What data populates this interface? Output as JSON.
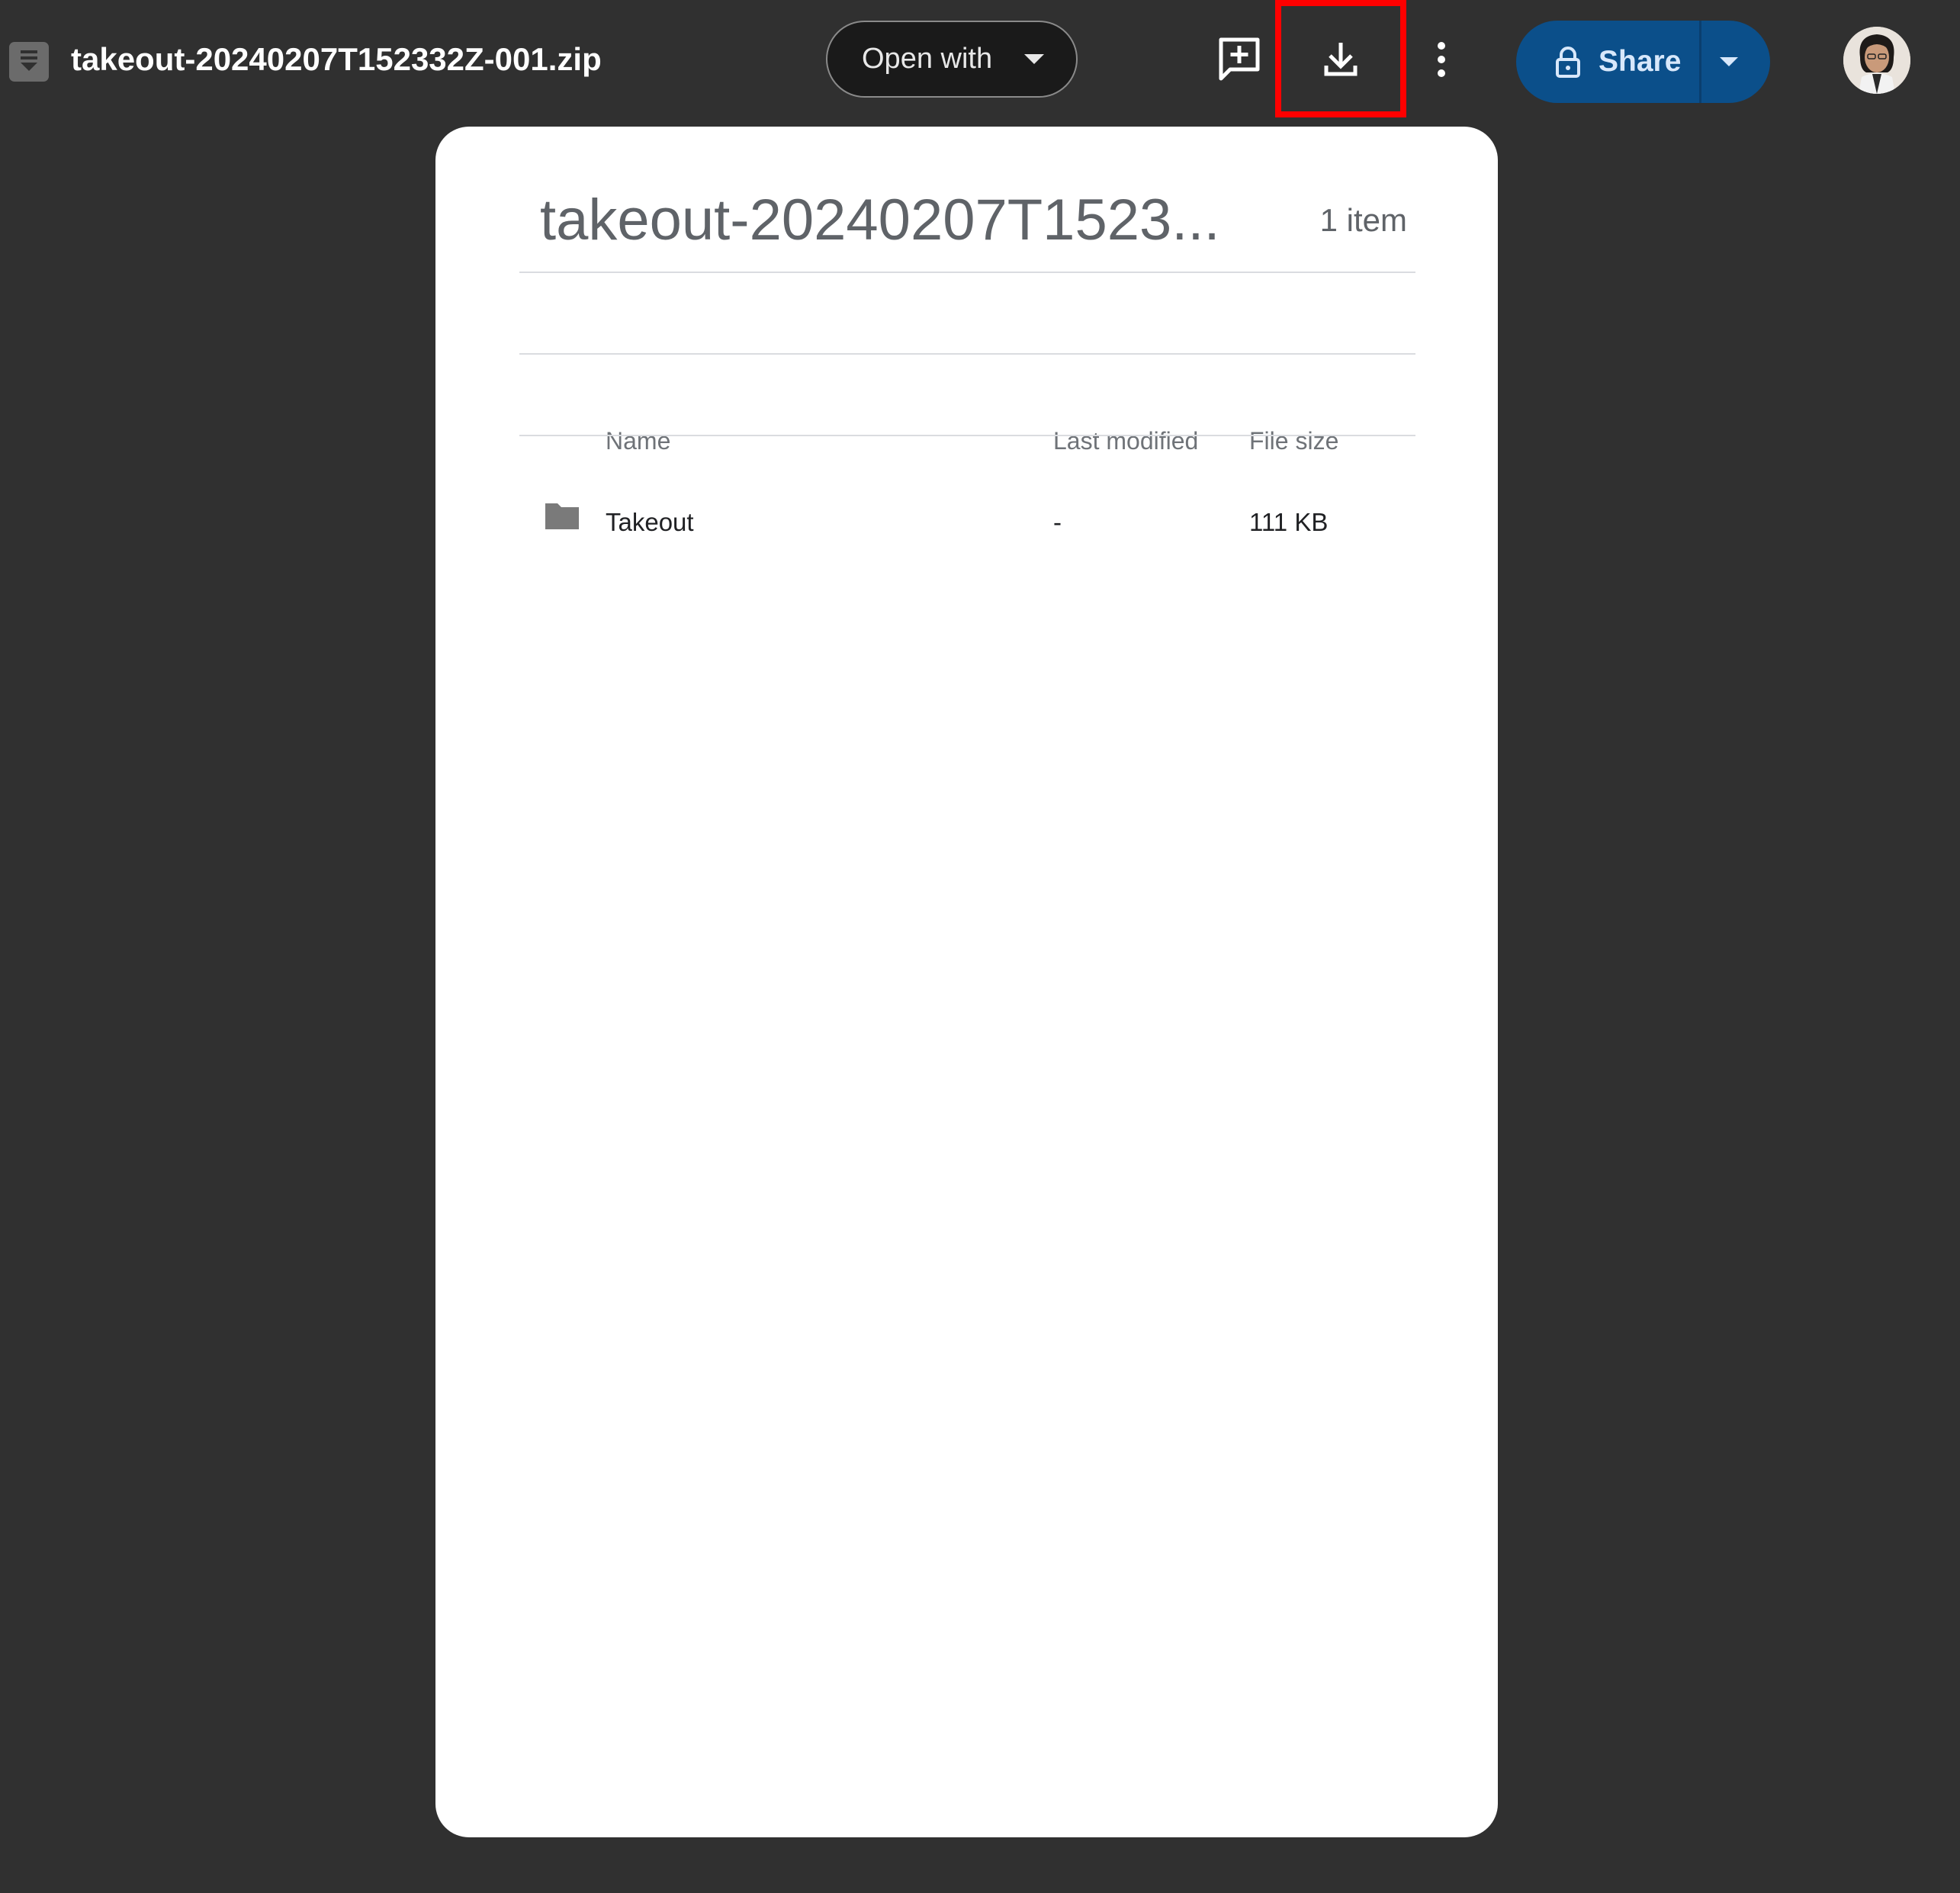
{
  "header": {
    "file_title": "takeout-20240207T152332Z-001.zip",
    "open_with_label": "Open with",
    "share_label": "Share"
  },
  "icons": {
    "file_type": "zip-file-icon",
    "open_with_caret": "chevron-down-icon",
    "add_comment": "add-comment-icon",
    "download": "download-icon",
    "more": "more-vert-icon",
    "lock": "lock-icon",
    "share_caret": "chevron-down-icon",
    "avatar": "user-avatar",
    "folder": "folder-icon"
  },
  "colors": {
    "background": "#303030",
    "share_button": "#0b4f8a",
    "highlight": "#ff0000",
    "card": "#ffffff"
  },
  "archive": {
    "title": "takeout-20240207T1523...",
    "item_count": "1 item",
    "columns": {
      "name": "Name",
      "last_modified": "Last modified",
      "file_size": "File size"
    },
    "rows": [
      {
        "name": "Takeout",
        "last_modified": "-",
        "file_size": "111 KB"
      }
    ]
  }
}
